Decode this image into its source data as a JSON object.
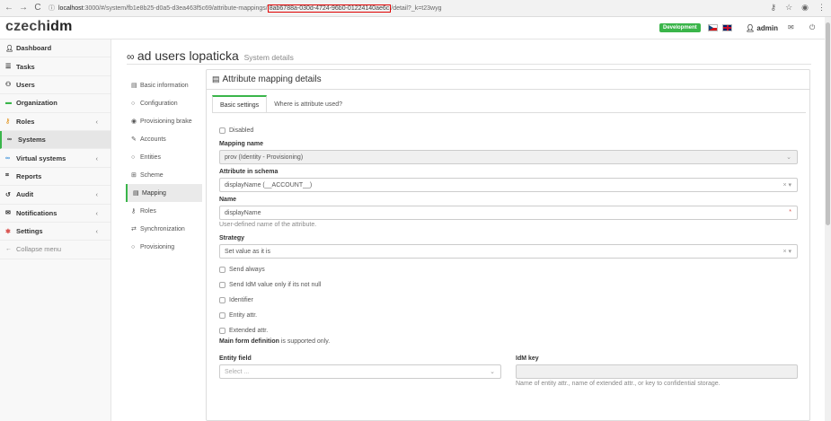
{
  "browser": {
    "url_prefix": "localhost",
    "url_middle": ":3000/#/system/fb1e8b25-d0a5-d3ea463f5c69/attribute-mappings/",
    "url_highlight": "8ab6788a-030d-4724-96b0-01224140ae6c",
    "url_suffix": "/detail?_k=t23wyg"
  },
  "header": {
    "logo_prefix": "czech",
    "logo_suffix": "idm",
    "env_badge": "Development",
    "user": "admin"
  },
  "sidebar": {
    "items": [
      {
        "label": "Dashboard",
        "icon": "user-icon"
      },
      {
        "label": "Tasks",
        "icon": "list-icon"
      },
      {
        "label": "Users",
        "icon": "users-icon"
      },
      {
        "label": "Organization",
        "icon": "folder-icon"
      },
      {
        "label": "Roles",
        "icon": "key-icon"
      },
      {
        "label": "Systems",
        "icon": "link-icon"
      },
      {
        "label": "Virtual systems",
        "icon": "link-icon"
      },
      {
        "label": "Reports",
        "icon": "chart-icon"
      },
      {
        "label": "Audit",
        "icon": "history-icon"
      },
      {
        "label": "Notifications",
        "icon": "envelope-icon"
      },
      {
        "label": "Settings",
        "icon": "gear-icon"
      },
      {
        "label": "Collapse menu",
        "icon": "arrow-left-icon"
      }
    ]
  },
  "page": {
    "title": "ad users lopaticka",
    "subtitle": "System details"
  },
  "detail_nav": {
    "items": [
      "Basic information",
      "Configuration",
      "Provisioning brake",
      "Accounts",
      "Entities",
      "Scheme",
      "Mapping",
      "Roles",
      "Synchronization",
      "Provisioning"
    ]
  },
  "panel": {
    "title": "Attribute mapping details",
    "tabs": [
      "Basic settings",
      "Where is attribute used?"
    ]
  },
  "form": {
    "disabled_label": "Disabled",
    "mapping_name_label": "Mapping name",
    "mapping_name_value": "prov (Identity - Provisioning)",
    "schema_attr_label": "Attribute in schema",
    "schema_attr_value": "displayName (__ACCOUNT__)",
    "name_label": "Name",
    "name_value": "displayName",
    "name_help": "User-defined name of the attribute.",
    "strategy_label": "Strategy",
    "strategy_value": "Set value as it is",
    "send_always": "Send always",
    "send_if_not_null": "Send IdM value only if its not null",
    "identifier": "Identifier",
    "entity_attr": "Entity attr.",
    "extended_attr": "Extended attr.",
    "note_bold": "Main form definition",
    "note_rest": " is supported only.",
    "entity_field_label": "Entity field",
    "entity_field_placeholder": "Select ...",
    "idm_key_label": "IdM key",
    "idm_key_help": "Name of entity attr., name of extended attr., or key to confidential storage."
  }
}
